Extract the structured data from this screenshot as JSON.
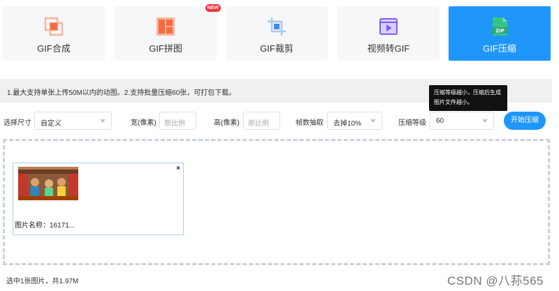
{
  "tools": [
    {
      "label": "GIF合成",
      "icon": "gif-merge-icon",
      "active": false
    },
    {
      "label": "GIF拼图",
      "icon": "gif-puzzle-icon",
      "active": false,
      "badge": "NEW"
    },
    {
      "label": "GIF裁剪",
      "icon": "crop-icon",
      "active": false
    },
    {
      "label": "视频转GIF",
      "icon": "video-play-icon",
      "active": false
    },
    {
      "label": "GIF压缩",
      "icon": "zip-file-icon",
      "active": true
    }
  ],
  "info": "1.最大支持单张上传50M以内的动图。2.支持批量压缩60张，可打包下载。",
  "tooltip": {
    "line1": "压缩等级越小，压缩后生成",
    "line2": "图片文件越小。"
  },
  "options": {
    "size_label": "选择尺寸",
    "size_value": "自定义",
    "width_label": "宽(像素)",
    "width_placeholder": "原比例",
    "height_label": "高(像素)",
    "height_placeholder": "原比例",
    "frame_label": "帧数抽取",
    "frame_value": "去掉10%",
    "level_label": "压缩等级",
    "level_value": "60",
    "start_button": "开始压缩"
  },
  "file": {
    "name_label": "图片名称：16171...",
    "close": "×"
  },
  "footer": "选中1张图片，共1.97M",
  "watermark": "CSDN @八荪565",
  "colors": {
    "accent": "#1e96fa",
    "icon_orange": "#f56c3d",
    "icon_purple": "#7b5cf0",
    "icon_green": "#35c48a",
    "badge": "#f2303a"
  }
}
